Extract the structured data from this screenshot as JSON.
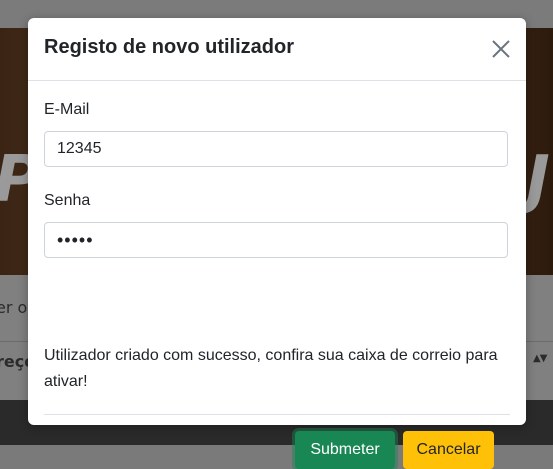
{
  "background": {
    "hero_text_left": "PR",
    "hero_text_right": "J",
    "content_line_1": "er o",
    "content_line_2": "reço",
    "sort_indicator": "▲▼"
  },
  "modal": {
    "title": "Registo de novo utilizador",
    "close_icon": "close-icon",
    "email": {
      "label": "E-Mail",
      "value": "12345"
    },
    "password": {
      "label": "Senha",
      "value": "12345"
    },
    "message": "Utilizador criado com sucesso, confira sua caixa de correio para ativar!",
    "submit_label": "Submeter",
    "cancel_label": "Cancelar"
  },
  "colors": {
    "submit": "#198754",
    "cancel": "#ffc107",
    "overlay": "#7a7a7a"
  }
}
